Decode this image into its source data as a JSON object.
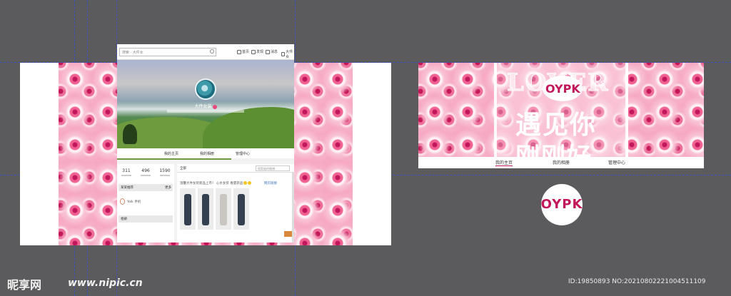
{
  "mockup": {
    "search_placeholder": "搜索 · 大件女",
    "nav": [
      "首页",
      "发现",
      "消息",
      "大件女"
    ],
    "profile_name": "大件女装",
    "tabs": [
      "我的主页",
      "我的相册",
      "管理中心"
    ],
    "stats": [
      "311",
      "496",
      "1590"
    ],
    "card1_title": "某某推荐",
    "card1_more": "更多",
    "card1_row": "Yolk 手机",
    "card2_title": "相册",
    "post_tab": "全部",
    "post_search": "搜索她的微博",
    "post_text": "温馨大件女装新品上市！ 心水女装 春夏新品",
    "post_link": "网页链接"
  },
  "banner": {
    "lover_text": "LOVER",
    "brand": "OYPK",
    "title_cn": "遇见你",
    "subtitle_cn": "刚刚好",
    "tabs": [
      "我的主页",
      "我的相册",
      "管理中心"
    ]
  },
  "logo": {
    "brand": "OYPK"
  },
  "watermark": {
    "site_logo": "昵享网",
    "url": "www.nipic.cn",
    "id_text": "ID:19850893 NO:20210802221004511109"
  },
  "colors": {
    "canvas": "#5b5b5d",
    "accent": "#c2185b",
    "guide": "#3d4fb8"
  }
}
